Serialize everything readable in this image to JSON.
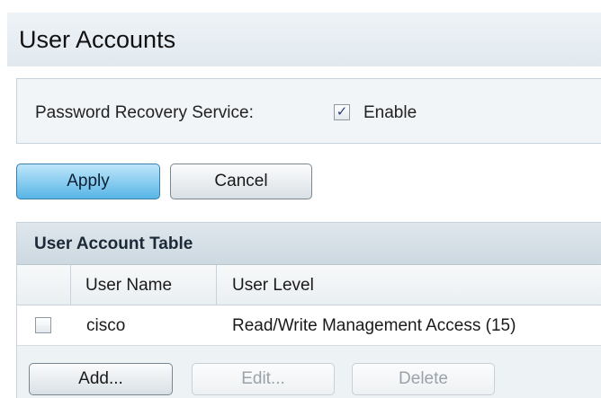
{
  "page": {
    "title": "User Accounts"
  },
  "password_recovery": {
    "label": "Password Recovery Service:",
    "checkbox_checked": true,
    "checkbox_mark": "✓",
    "enable_label": "Enable"
  },
  "actions": {
    "apply_label": "Apply",
    "cancel_label": "Cancel"
  },
  "user_table": {
    "caption": "User Account Table",
    "columns": [
      "",
      "User Name",
      "User Level"
    ],
    "rows": [
      {
        "checked": false,
        "user_name": "cisco",
        "user_level": "Read/Write Management Access (15)"
      }
    ],
    "add_label": "Add...",
    "edit_label": "Edit...",
    "delete_label": "Delete"
  },
  "colors": {
    "accent_button": "#57b5e6",
    "table_header": "#cdd8e0",
    "panel_background": "#f1f5f8"
  }
}
